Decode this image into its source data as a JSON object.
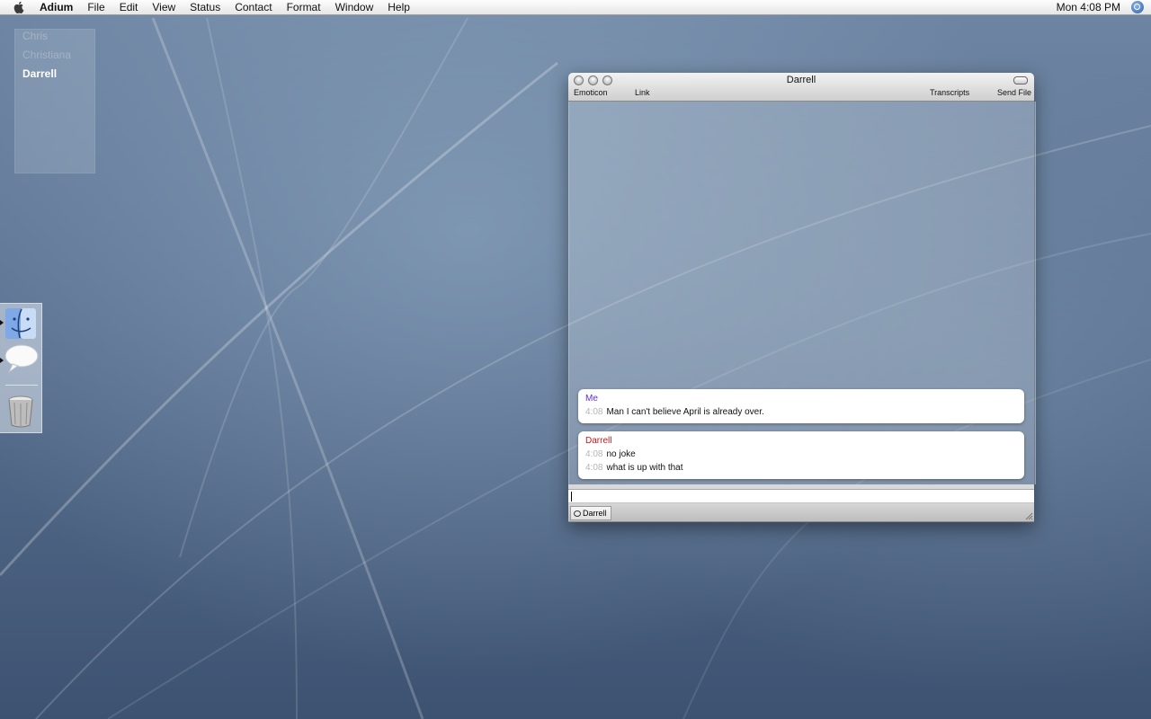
{
  "menubar": {
    "app_name": "Adium",
    "items": [
      "File",
      "Edit",
      "View",
      "Status",
      "Contact",
      "Format",
      "Window",
      "Help"
    ],
    "clock": "Mon 4:08 PM"
  },
  "contact_list": {
    "contacts": [
      {
        "name": "Chris",
        "active": false
      },
      {
        "name": "Christiana",
        "active": false
      },
      {
        "name": "Darrell",
        "active": true
      }
    ]
  },
  "dock": {
    "items": [
      "finder-icon",
      "chat-bubble-icon",
      "trash-icon"
    ]
  },
  "chat_window": {
    "title": "Darrell",
    "toolbar": {
      "emoticon": "Emoticon",
      "link": "Link",
      "transcripts": "Transcripts",
      "send_file": "Send File"
    },
    "messages": [
      {
        "sender": "Me",
        "sender_color": "#5a2fd1",
        "lines": [
          {
            "time": "4:08",
            "text": "Man I can't believe April is already over."
          }
        ]
      },
      {
        "sender": "Darrell",
        "sender_color": "#c0171a",
        "lines": [
          {
            "time": "4:08",
            "text": "no joke"
          },
          {
            "time": "4:08",
            "text": "what is up with that"
          }
        ]
      }
    ],
    "input_value": "",
    "tab_label": "Darrell"
  }
}
